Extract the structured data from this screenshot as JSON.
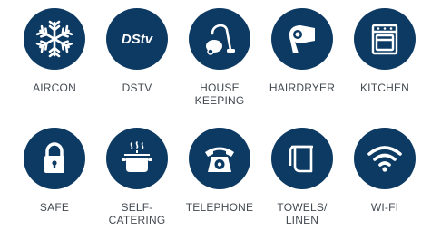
{
  "icon_color": "#0c3a63",
  "label_color": "#444a52",
  "amenities": [
    {
      "label": "AIRCON",
      "icon": "snowflake-icon"
    },
    {
      "label": "DSTV",
      "icon": "dstv-logo-icon",
      "logo_text": "DStv"
    },
    {
      "label": "HOUSE\nKEEPING",
      "icon": "vacuum-cleaner-icon"
    },
    {
      "label": "HAIRDRYER",
      "icon": "hairdryer-icon"
    },
    {
      "label": "KITCHEN",
      "icon": "stove-icon"
    },
    {
      "label": "SAFE",
      "icon": "padlock-icon"
    },
    {
      "label": "SELF-\nCATERING",
      "icon": "cooking-pot-icon"
    },
    {
      "label": "TELEPHONE",
      "icon": "telephone-icon"
    },
    {
      "label": "TOWELS/\nLINEN",
      "icon": "towel-icon"
    },
    {
      "label": "WI-FI",
      "icon": "wifi-icon"
    }
  ]
}
